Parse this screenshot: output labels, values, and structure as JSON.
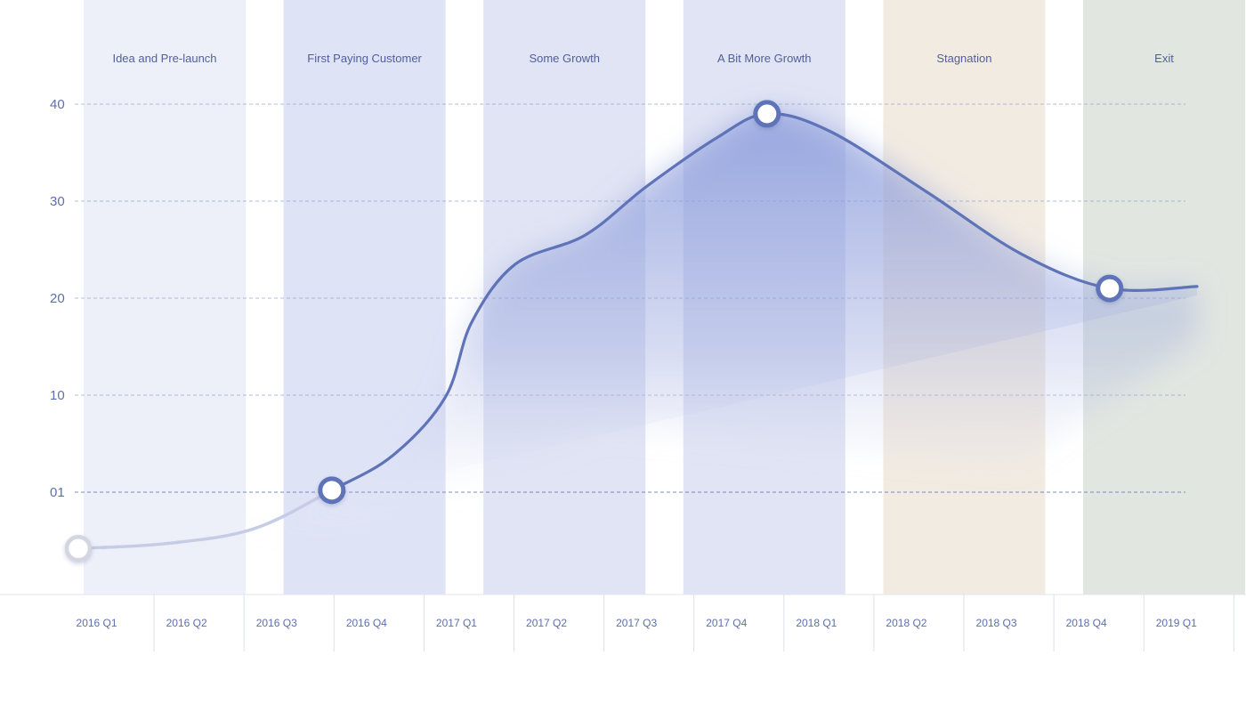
{
  "chart_data": {
    "type": "area",
    "title": "",
    "xlabel": "",
    "ylabel": "",
    "y_ticks": [
      "40",
      "30",
      "20",
      "10",
      "01"
    ],
    "y_tick_values": [
      40,
      30,
      20,
      10,
      0
    ],
    "ylim": [
      -6,
      45
    ],
    "grid": true,
    "categories": [
      "2016 Q1",
      "2016 Q2",
      "2016 Q3",
      "2016 Q4",
      "2017 Q1",
      "2017 Q2",
      "2017 Q3",
      "2017 Q4",
      "2018 Q1",
      "2018 Q2",
      "2018 Q3",
      "2018 Q4",
      "2019 Q1"
    ],
    "phases": [
      {
        "label": "Idea and Pre-launch",
        "color": "#eef0f9"
      },
      {
        "label": "First Paying Customer",
        "color": "#dfe3f6"
      },
      {
        "label": "Some Growth",
        "color": "#e1e4f4"
      },
      {
        "label": "A Bit More Growth",
        "color": "#e1e4f4"
      },
      {
        "label": "Stagnation",
        "color": "#f2ebe2"
      },
      {
        "label": "Exit",
        "color": "#e1e6e1"
      }
    ],
    "series": [
      {
        "color": "#5f73b8",
        "points": [
          {
            "x": 0.0,
            "y": -5.8
          },
          {
            "x": 1.0,
            "y": -5.3
          },
          {
            "x": 2.0,
            "y": -3.8
          },
          {
            "x": 2.9,
            "y": 0.2
          },
          {
            "x": 3.6,
            "y": 3.8
          },
          {
            "x": 4.2,
            "y": 9.8
          },
          {
            "x": 4.5,
            "y": 17.5
          },
          {
            "x": 5.0,
            "y": 23.5
          },
          {
            "x": 5.8,
            "y": 26.5
          },
          {
            "x": 6.5,
            "y": 31.5
          },
          {
            "x": 7.3,
            "y": 36.5
          },
          {
            "x": 7.88,
            "y": 39.0
          },
          {
            "x": 8.6,
            "y": 37.2
          },
          {
            "x": 9.7,
            "y": 31.0
          },
          {
            "x": 10.8,
            "y": 24.5
          },
          {
            "x": 11.8,
            "y": 21.0
          },
          {
            "x": 12.8,
            "y": 21.2
          }
        ],
        "highlighted": [
          {
            "x": 0.0,
            "y": -5.8,
            "muted": true
          },
          {
            "x": 2.9,
            "y": 0.2
          },
          {
            "x": 7.88,
            "y": 39.0
          },
          {
            "x": 11.8,
            "y": 21.0
          }
        ]
      }
    ]
  }
}
